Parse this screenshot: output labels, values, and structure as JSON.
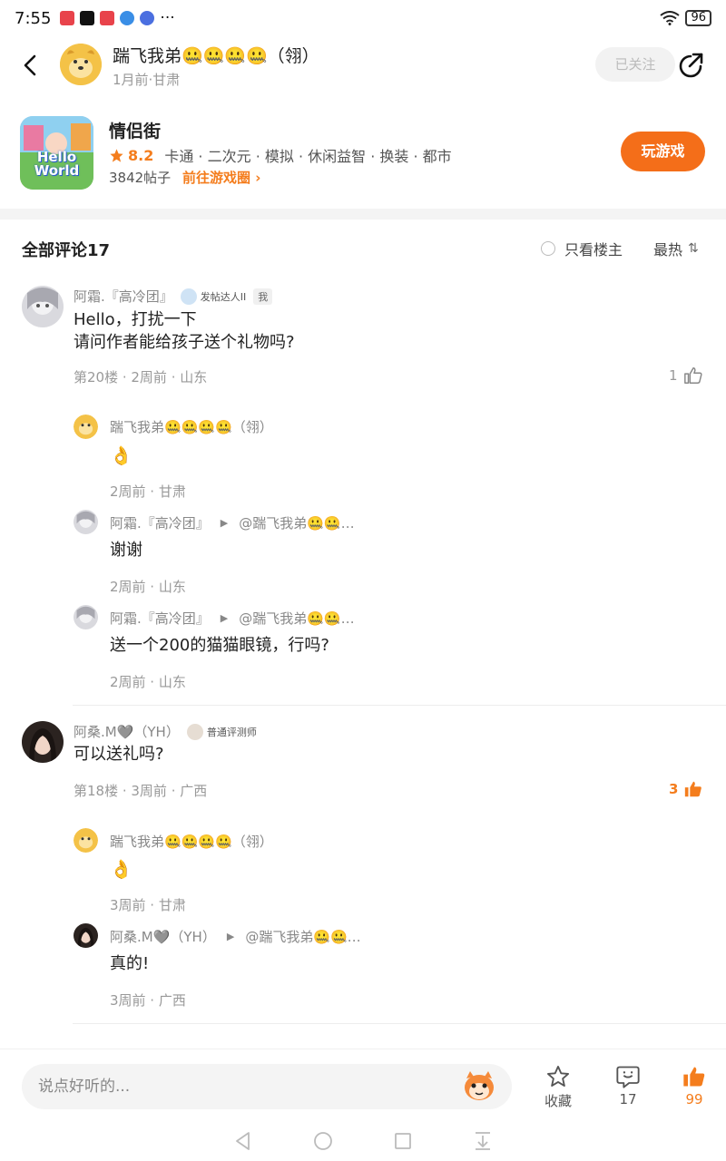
{
  "status_bar": {
    "time": "7:55",
    "signal": "6",
    "battery": "96",
    "more": "···"
  },
  "header": {
    "author_name": "踹飞我弟🤐🤐🤐🤐（翎）",
    "author_meta": "1月前·甘肃",
    "follow_label": "已关注"
  },
  "game": {
    "name": "情侣街",
    "rating": "8.2",
    "tags": "卡通 · 二次元 · 模拟 · 休闲益智 · 换装 · 都市",
    "posts": "3842帖子",
    "goto": "前往游戏圈",
    "thumb_text_1": "Hello",
    "thumb_text_2": "World",
    "play_label": "玩游戏"
  },
  "comments_section": {
    "title": "全部评论17",
    "only_op": "只看楼主",
    "sort": "最热"
  },
  "comments": [
    {
      "name": "阿霜.『高冷团』",
      "badge": "发帖达人II",
      "me_tag": "我",
      "line1": "Hello，打扰一下",
      "line2": "请问作者能给孩子送个礼物吗?",
      "meta": "第20楼 · 2周前 · 山东",
      "likes": "1",
      "replies": [
        {
          "name": "踹飞我弟🤐🤐🤐🤐（翎）",
          "target": "",
          "text": "👌",
          "meta": "2周前 · 甘肃"
        },
        {
          "name": "阿霜.『高冷团』",
          "target": "@踹飞我弟🤐🤐…",
          "text": "谢谢",
          "meta": "2周前 · 山东"
        },
        {
          "name": "阿霜.『高冷团』",
          "target": "@踹飞我弟🤐🤐…",
          "text": "送一个200的猫猫眼镜，行吗?",
          "meta": "2周前 · 山东"
        }
      ]
    },
    {
      "name": "阿桑.M🩶（YH）",
      "badge": "普通评测师",
      "line1": "可以送礼吗?",
      "meta": "第18楼 · 3周前 · 广西",
      "likes": "3",
      "replies": [
        {
          "name": "踹飞我弟🤐🤐🤐🤐（翎）",
          "target": "",
          "text": "👌",
          "meta": "3周前 · 甘肃"
        },
        {
          "name": "阿桑.M🩶（YH）",
          "target": "@踹飞我弟🤐🤐…",
          "text": "真的!",
          "meta": "3周前 · 广西"
        }
      ]
    }
  ],
  "bottom_bar": {
    "input_placeholder": "说点好听的...",
    "collect_label": "收藏",
    "comment_count": "17",
    "like_count": "99"
  },
  "colors": {
    "accent": "#f47d1d",
    "play_button": "#f46e19"
  }
}
